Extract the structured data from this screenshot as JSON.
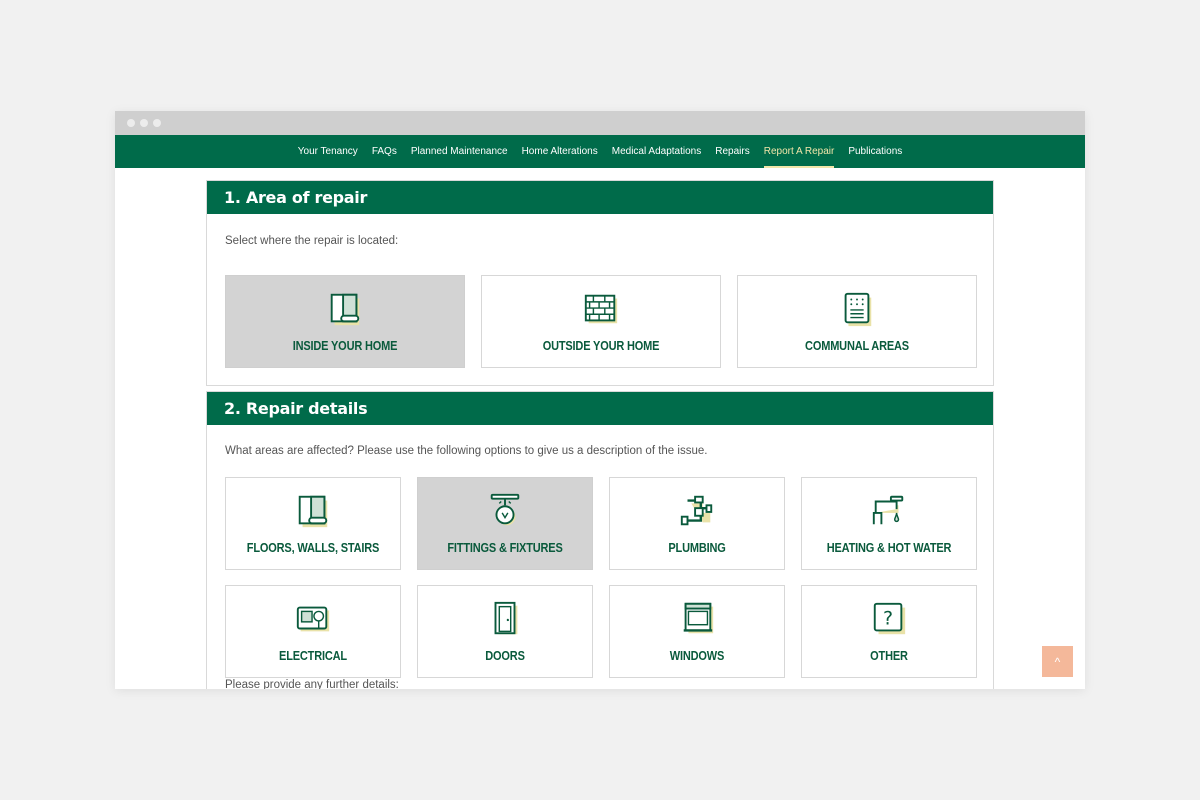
{
  "nav": {
    "items": [
      {
        "label": "Your Tenancy",
        "active": false
      },
      {
        "label": "FAQs",
        "active": false
      },
      {
        "label": "Planned Maintenance",
        "active": false
      },
      {
        "label": "Home Alterations",
        "active": false
      },
      {
        "label": "Medical Adaptations",
        "active": false
      },
      {
        "label": "Repairs",
        "active": false
      },
      {
        "label": "Report A Repair",
        "active": true
      },
      {
        "label": "Publications",
        "active": false
      }
    ]
  },
  "area": {
    "title": "1. Area of repair",
    "intro": "Select where the repair is located:",
    "options": [
      {
        "label": "INSIDE YOUR HOME",
        "icon": "wallpaper-icon",
        "selected": true
      },
      {
        "label": "OUTSIDE YOUR HOME",
        "icon": "brick-wall-icon",
        "selected": false
      },
      {
        "label": "COMMUNAL AREAS",
        "icon": "intercom-panel-icon",
        "selected": false
      }
    ]
  },
  "details": {
    "title": "2. Repair details",
    "intro": "What areas are affected? Please use the following options to give us a description of the issue.",
    "options": [
      {
        "label": "FLOORS, WALLS, STAIRS",
        "icon": "wallpaper-icon",
        "selected": false
      },
      {
        "label": "FITTINGS & FIXTURES",
        "icon": "ceiling-light-icon",
        "selected": true
      },
      {
        "label": "PLUMBING",
        "icon": "pipe-icon",
        "selected": false
      },
      {
        "label": "HEATING & HOT WATER",
        "icon": "tap-icon",
        "selected": false
      },
      {
        "label": "ELECTRICAL",
        "icon": "socket-icon",
        "selected": false
      },
      {
        "label": "DOORS",
        "icon": "door-icon",
        "selected": false
      },
      {
        "label": "WINDOWS",
        "icon": "window-icon",
        "selected": false
      },
      {
        "label": "OTHER",
        "icon": "question-icon",
        "selected": false
      }
    ],
    "further_label": "Please provide any further details:"
  },
  "scroll_top": {
    "icon": "chevron-up-icon",
    "glyph": "^"
  },
  "colors": {
    "brand_green": "#006b4a",
    "accent_yellow": "#f1e6a9",
    "selected_gray": "#d3d3d3",
    "scroll_button": "#f4b89a"
  }
}
